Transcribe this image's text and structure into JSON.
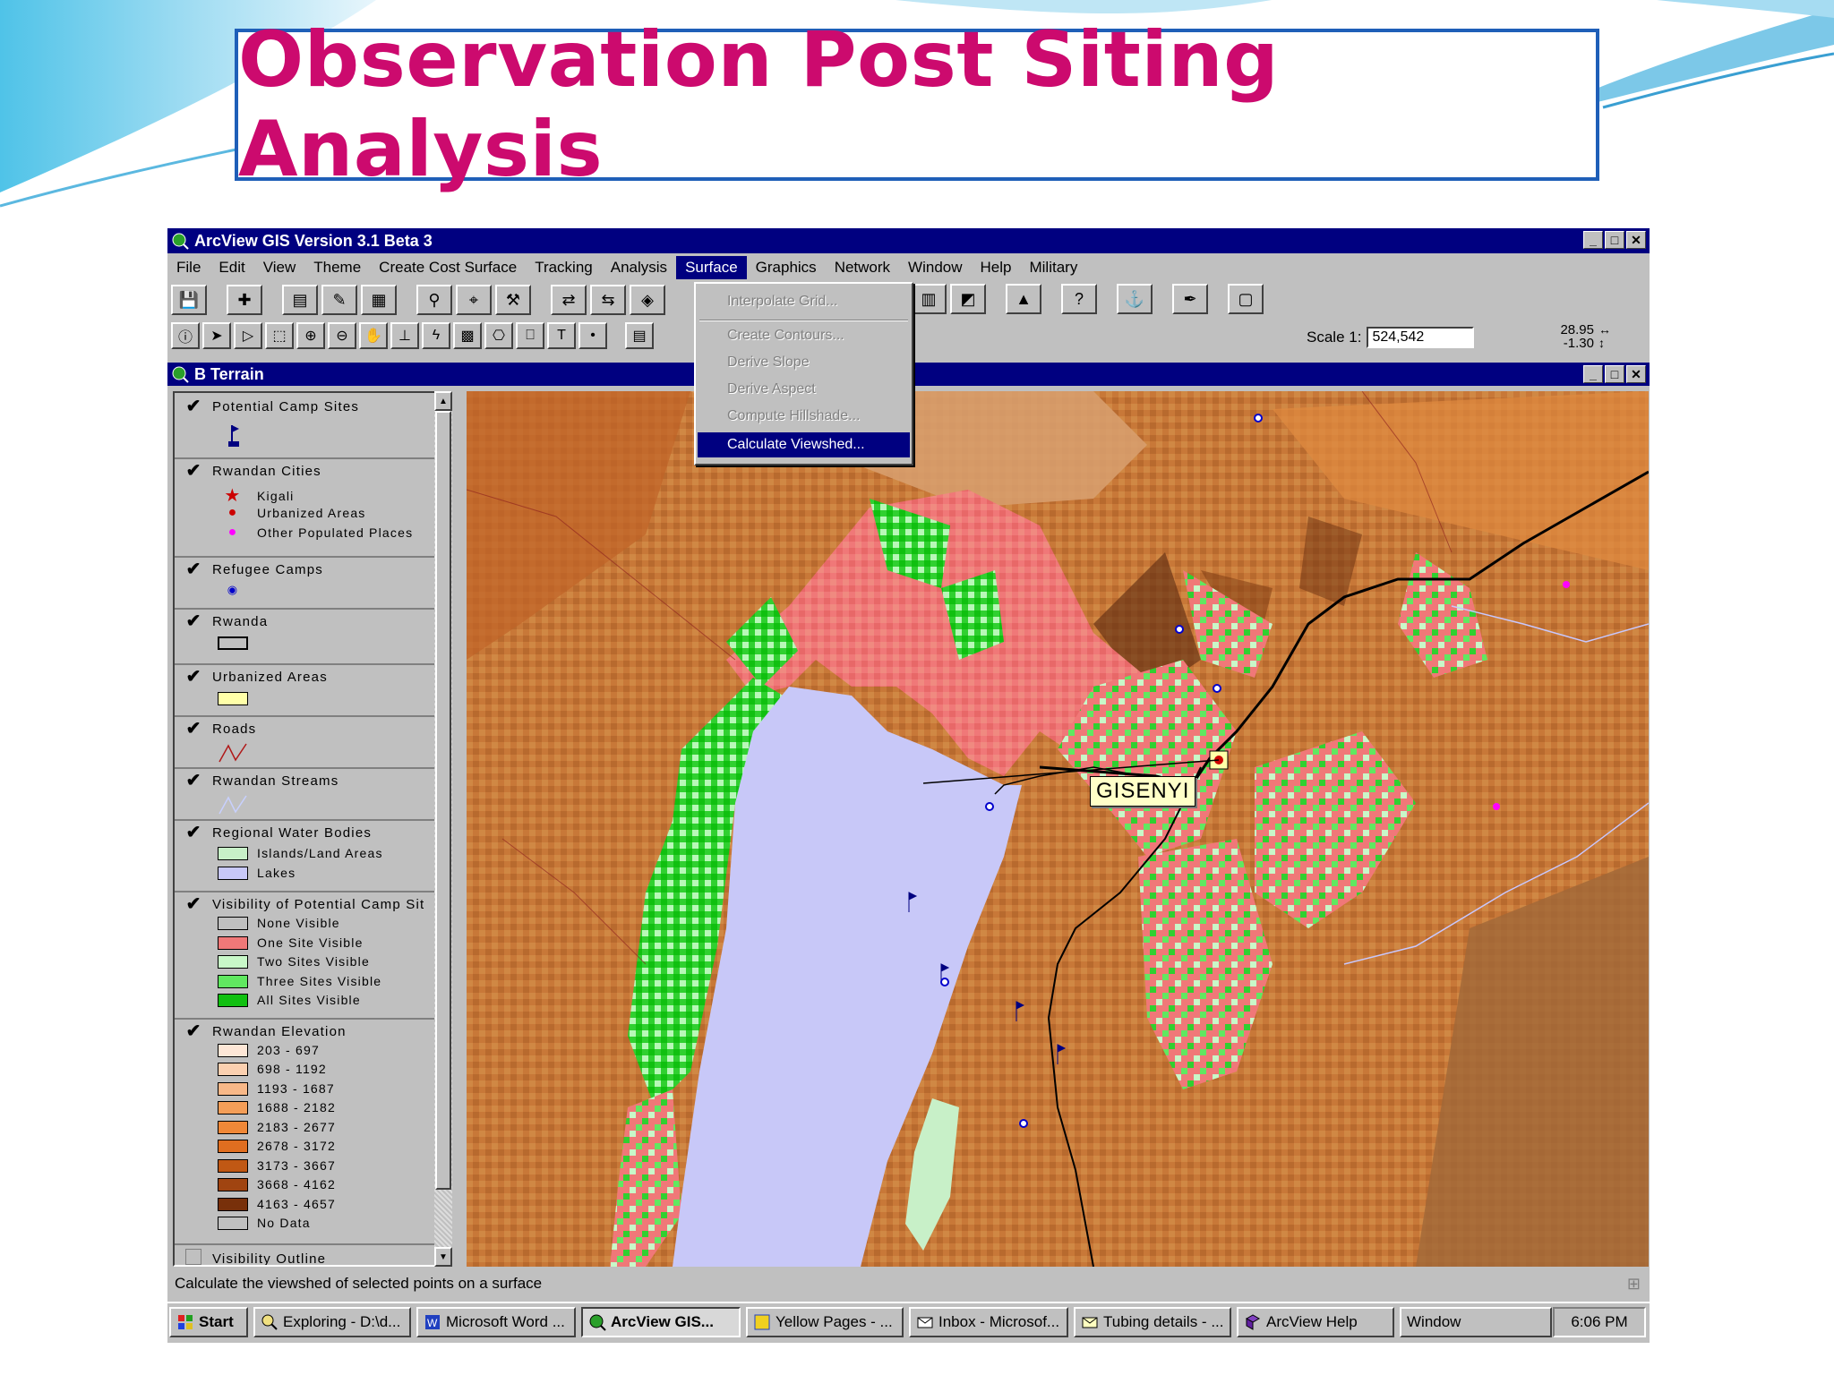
{
  "slide": {
    "title": "Observation Post Siting Analysis"
  },
  "app": {
    "title": "ArcView GIS Version 3.1 Beta 3",
    "menus": [
      "File",
      "Edit",
      "View",
      "Theme",
      "Create Cost Surface",
      "Tracking",
      "Analysis",
      "Surface",
      "Graphics",
      "Network",
      "Window",
      "Help",
      "Military"
    ],
    "active_menu": "Surface",
    "scale_label": "Scale 1:",
    "scale_value": "524,542",
    "coord_x": "28.95",
    "coord_y": "-1.30"
  },
  "view": {
    "title": "B Terrain"
  },
  "surface_menu": {
    "items": [
      {
        "label": "Interpolate Grid...",
        "enabled": false
      },
      {
        "label": "Create Contours...",
        "enabled": false
      },
      {
        "label": "Derive Slope",
        "enabled": false
      },
      {
        "label": "Derive Aspect",
        "enabled": false
      },
      {
        "label": "Compute Hillshade...",
        "enabled": false
      },
      {
        "label": "Calculate Viewshed...",
        "enabled": true
      }
    ]
  },
  "legend": {
    "potential_camp_sites": "Potential Camp Sites",
    "rwandan_cities": "Rwandan Cities",
    "cities": [
      {
        "label": "Kigali",
        "icon": "star-icon",
        "color": "#cc0000"
      },
      {
        "label": "Urbanized Areas",
        "icon": "dot-icon",
        "color": "#cc0000"
      },
      {
        "label": "Other Populated Places",
        "icon": "dot-icon",
        "color": "#ff00ff"
      }
    ],
    "refugee_camps": "Refugee Camps",
    "rwanda": "Rwanda",
    "urbanized_areas": "Urbanized Areas",
    "roads": "Roads",
    "streams": "Rwandan Streams",
    "water_bodies": "Regional Water Bodies",
    "water_items": [
      {
        "label": "Islands/Land Areas",
        "color": "#c8f0c8"
      },
      {
        "label": "Lakes",
        "color": "#c8c8f8"
      }
    ],
    "visibility": "Visibility of Potential Camp Sit",
    "visibility_items": [
      {
        "label": "None Visible",
        "color": "#c0c0c0"
      },
      {
        "label": "One Site Visible",
        "color": "#f07878"
      },
      {
        "label": "Two Sites Visible",
        "color": "#c8f8c8"
      },
      {
        "label": "Three Sites Visible",
        "color": "#60e860"
      },
      {
        "label": "All Sites Visible",
        "color": "#10c010"
      }
    ],
    "elevation": "Rwandan Elevation",
    "elevation_items": [
      {
        "label": "203 - 697",
        "color": "#fde6d6"
      },
      {
        "label": "698 - 1192",
        "color": "#fbd0b0"
      },
      {
        "label": "1193 - 1687",
        "color": "#f8b888"
      },
      {
        "label": "1688 - 2182",
        "color": "#f49e58"
      },
      {
        "label": "2183 - 2677",
        "color": "#f08838"
      },
      {
        "label": "2678 - 3172",
        "color": "#e06e20"
      },
      {
        "label": "3173 - 3667",
        "color": "#c05814"
      },
      {
        "label": "3668 - 4162",
        "color": "#a04410"
      },
      {
        "label": "4163 - 4657",
        "color": "#78300a"
      },
      {
        "label": "No Data",
        "color": "#c0c0c0"
      }
    ],
    "visibility_outline": "Visibility Outline"
  },
  "map": {
    "label": "GISENYI"
  },
  "status": "Calculate the viewshed of selected points on a surface",
  "taskbar": {
    "start": "Start",
    "tasks": [
      "Exploring - D:\\d...",
      "Microsoft Word ...",
      "ArcView GIS...",
      "Yellow Pages - ...",
      "Inbox - Microsof...",
      "Tubing details - ...",
      "ArcView Help",
      "Window"
    ],
    "clock": "6:06 PM"
  }
}
